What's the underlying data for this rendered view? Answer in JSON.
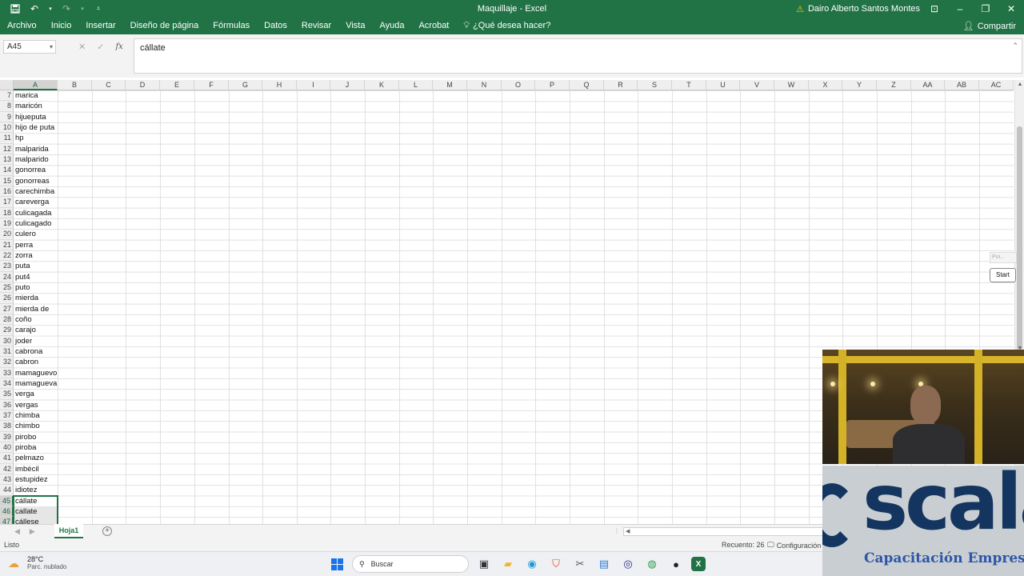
{
  "window": {
    "title": "Maquillaje  -  Excel",
    "user_name": "Dairo Alberto Santos Montes"
  },
  "ribbon": {
    "tabs": [
      "Archivo",
      "Inicio",
      "Insertar",
      "Diseño de página",
      "Fórmulas",
      "Datos",
      "Revisar",
      "Vista",
      "Ayuda",
      "Acrobat"
    ],
    "tell_me": "¿Qué desea hacer?",
    "share": "Compartir"
  },
  "formula_bar": {
    "name_box": "A45",
    "content": "cállate"
  },
  "columns": [
    "A",
    "B",
    "C",
    "D",
    "E",
    "F",
    "G",
    "H",
    "I",
    "J",
    "K",
    "L",
    "M",
    "N",
    "O",
    "P",
    "Q",
    "R",
    "S",
    "T",
    "U",
    "V",
    "W",
    "X",
    "Y",
    "Z",
    "AA",
    "AB",
    "AC"
  ],
  "rows": [
    {
      "num": "7",
      "a": "marica"
    },
    {
      "num": "8",
      "a": "maricón"
    },
    {
      "num": "9",
      "a": "hijueputa"
    },
    {
      "num": "10",
      "a": "hijo de puta"
    },
    {
      "num": "11",
      "a": "hp"
    },
    {
      "num": "12",
      "a": "malparida"
    },
    {
      "num": "13",
      "a": "malparido"
    },
    {
      "num": "14",
      "a": "gonorrea"
    },
    {
      "num": "15",
      "a": "gonorreas"
    },
    {
      "num": "16",
      "a": "carechimba"
    },
    {
      "num": "17",
      "a": "careverga"
    },
    {
      "num": "18",
      "a": "culicagada"
    },
    {
      "num": "19",
      "a": "culicagado"
    },
    {
      "num": "20",
      "a": "culero"
    },
    {
      "num": "21",
      "a": "perra"
    },
    {
      "num": "22",
      "a": "zorra"
    },
    {
      "num": "23",
      "a": "puta"
    },
    {
      "num": "24",
      "a": "put4"
    },
    {
      "num": "25",
      "a": "puto"
    },
    {
      "num": "26",
      "a": "mierda"
    },
    {
      "num": "27",
      "a": "mierda de"
    },
    {
      "num": "28",
      "a": "coño"
    },
    {
      "num": "29",
      "a": "carajo"
    },
    {
      "num": "30",
      "a": "joder"
    },
    {
      "num": "31",
      "a": "cabrona"
    },
    {
      "num": "32",
      "a": "cabron"
    },
    {
      "num": "33",
      "a": "mamaguevo"
    },
    {
      "num": "34",
      "a": "mamagueva"
    },
    {
      "num": "35",
      "a": "verga"
    },
    {
      "num": "36",
      "a": "vergas"
    },
    {
      "num": "37",
      "a": "chimba"
    },
    {
      "num": "38",
      "a": "chimbo"
    },
    {
      "num": "39",
      "a": "pirobo"
    },
    {
      "num": "40",
      "a": "piroba"
    },
    {
      "num": "41",
      "a": "pelmazo"
    },
    {
      "num": "42",
      "a": "imbécil"
    },
    {
      "num": "43",
      "a": "estupidez"
    },
    {
      "num": "44",
      "a": "idiotez"
    },
    {
      "num": "45",
      "a": "cállate"
    },
    {
      "num": "46",
      "a": "callate"
    },
    {
      "num": "47",
      "a": "cállese"
    }
  ],
  "widget": {
    "poi_label": "Poi...",
    "start_label": "Start"
  },
  "sheets": {
    "active": "Hoja1"
  },
  "status": {
    "ready": "Listo",
    "count": "Recuento: 26",
    "config": "Configuración d"
  },
  "taskbar": {
    "temperature": "28°C",
    "condition": "Parc. nublado",
    "search_placeholder": "Buscar"
  },
  "overlay": {
    "logo_text": "scala",
    "logo_subtitle": "Capacitación Empresa"
  },
  "colors": {
    "excel_green": "#217346",
    "selection": "#217346"
  }
}
